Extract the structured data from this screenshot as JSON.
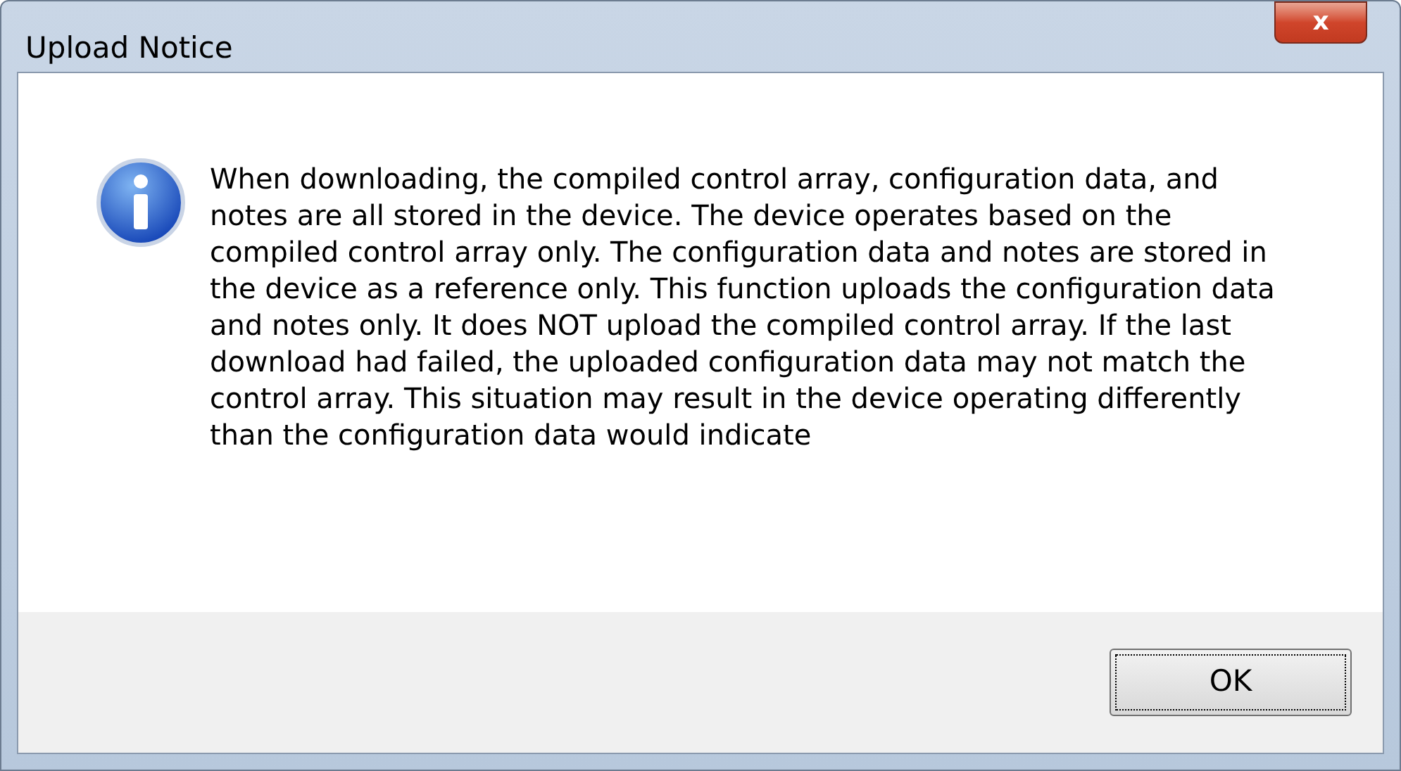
{
  "window": {
    "title": "Upload Notice",
    "close_label": "x"
  },
  "message": "When downloading, the compiled control array, configuration data, and notes are all stored in the device. The device operates based on the compiled control array only. The configuration data and notes are stored in the device as a reference only. This function uploads the configuration data and notes only. It does NOT upload the compiled control array. If the last download had failed, the uploaded configuration data may not match the control array. This situation may result in the device operating differently than the configuration data would indicate",
  "buttons": [
    "OK"
  ]
}
